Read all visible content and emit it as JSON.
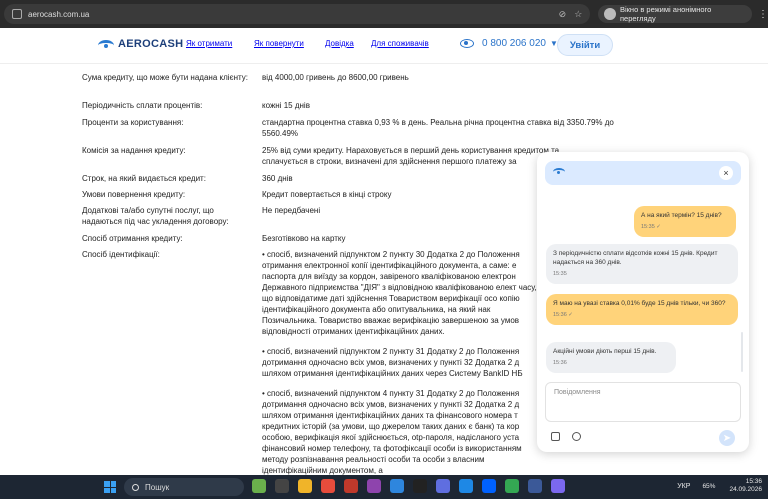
{
  "browser": {
    "url": "aerocash.com.ua",
    "incognito_label": "Вікно в режимі анонімного перегляду"
  },
  "header": {
    "logo_text": "AEROCASH",
    "nav": [
      "Як отримати",
      "Як повернути",
      "Довідка",
      "Для споживачів"
    ],
    "phone": "0 800 206 020",
    "login_label": "Увійти"
  },
  "table": {
    "rows": [
      {
        "k": "Сума кредиту, що може бути надана клієнту:",
        "v": "від 4000,00 гривень до 8600,00 гривень"
      },
      {
        "k": "Періодичність сплати процентів:",
        "v": "кожні 15 днів"
      },
      {
        "k": "Проценти за користування:",
        "v": "стандартна процентна ставка 0,93 % в день. Реальна річна процентна ставка від 3350.79% до 5560.49%"
      },
      {
        "k": "Комісія за надання кредиту:",
        "v": "25% від суми кредиту. Нараховується в перший день користування кредитом та сплачується в строки, визначені для здійснення першого платежу за"
      },
      {
        "k": "Строк, на який видається кредит:",
        "v": "360 днів"
      },
      {
        "k": "Умови повернення кредиту:",
        "v": "Кредит повертається в кінці строку"
      },
      {
        "k": "Додаткові та/або супутні послуг, що надаються під час укладення договору:",
        "v": "Не передбачені"
      },
      {
        "k": "Спосіб отримання кредиту:",
        "v": "Безготівково на картку"
      },
      {
        "k": "Спосіб ідентифікації:",
        "v": ""
      }
    ],
    "ident_paragraphs": [
      "• спосіб, визначений підпунктом 2 пункту 30 Додатка 2 до Положення отримання електронної копії ідентифікаційного документа, а саме: е паспорта для виїзду за кордон, завіреного кваліфікованою електрон Державного підприємства \"ДІЯ\" з відповідною кваліфікованою елект часу, що відповідатиме даті здійснення Товариством верифікації осо копію ідентифікаційного документа або опитувальника, на який нак Позичальника. Товариство вважає верифікацію завершеною за умов відповідності отриманих ідентифікаційних даних.",
      "• спосіб, визначений підпунктом 2 пункту 31 Додатку 2 до Положення дотримання одночасно всіх умов, визначених у пункті 32 Додатка 2 д шляхом отримання ідентифікаційних даних через Систему BankID НБ",
      "• спосіб, визначений підпунктом 4 пункту 31 Додатку 2 до Положення дотримання одночасно всіх умов, визначених у пункті 32 Додатка 2 д шляхом отримання ідентифікаційних даних та фінансового номера т кредитних історій (за умови, що джерелом таких даних є банк) та кор особою, верифікація якої здійснюється, otp-пароля, надісланого уста фінансовий номер телефону, та фотофіксації особи із використанням методу розпізнавання реальності особи та особи з власним ідентифікаційним документом, а"
    ]
  },
  "chat": {
    "messages": [
      {
        "from": "user",
        "text": "А на який термін? 15 днів?",
        "time": "15:35",
        "check": "✓"
      },
      {
        "from": "bot",
        "text": "З періодичністю сплати відсотків кожні 15 днів. Кредит надається на 360 днів.",
        "time": "15:35"
      },
      {
        "from": "user",
        "text": "Я маю на увазі ставка 0,01% буде 15 днів тільки, чи 360?",
        "time": "15:36",
        "check": "✓"
      },
      {
        "from": "bot",
        "text": "Акційні умови діють перші 15 днів.",
        "time": "15:36"
      }
    ],
    "input_placeholder": "Повідомлення",
    "close": "×",
    "send": "➤"
  },
  "taskbar": {
    "search_label": "Пошук",
    "lang": "УКР",
    "battery": "65%",
    "time": "15:36",
    "date": "24.09.2026"
  }
}
